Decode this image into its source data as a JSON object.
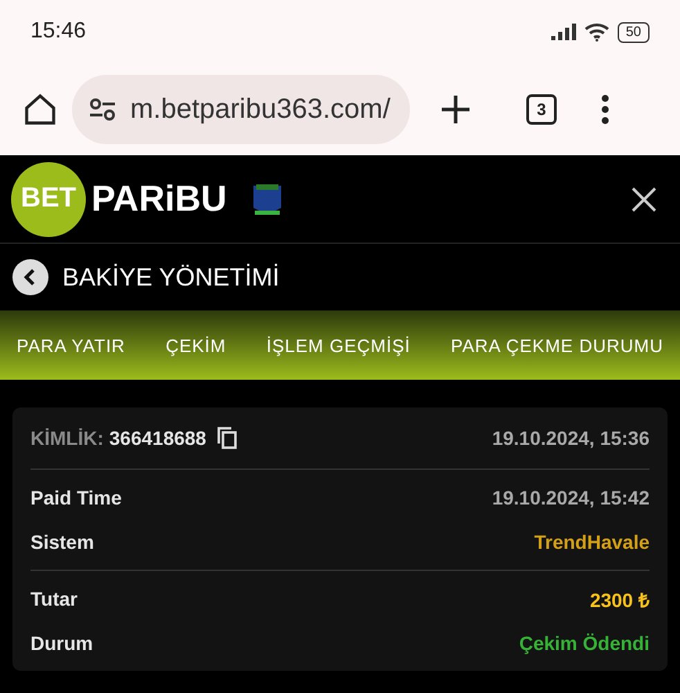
{
  "status_bar": {
    "time": "15:46",
    "battery": "50"
  },
  "browser": {
    "url": "m.betparibu363.com/",
    "tab_count": "3"
  },
  "header": {
    "logo_badge": "BET",
    "logo_text": "PARiBU"
  },
  "page_title": "BAKİYE YÖNETİMİ",
  "tabs": [
    {
      "label": "PARA YATIR"
    },
    {
      "label": "ÇEKİM"
    },
    {
      "label": "İŞLEM GEÇMİŞİ"
    },
    {
      "label": "PARA ÇEKME DURUMU"
    }
  ],
  "card": {
    "id_label": "KİMLİK:",
    "id_value": "366418688",
    "date": "19.10.2024, 15:36",
    "sections": [
      [
        {
          "label": "Paid Time",
          "value": "19.10.2024, 15:42",
          "color": "#a9a9a9"
        },
        {
          "label": "Sistem",
          "value": "TrendHavale",
          "color": "#d4a017"
        }
      ],
      [
        {
          "label": "Tutar",
          "value": "2300 ₺",
          "color": "#f7c21c"
        },
        {
          "label": "Durum",
          "value": "Çekim Ödendi",
          "color": "#36b336"
        }
      ]
    ]
  }
}
